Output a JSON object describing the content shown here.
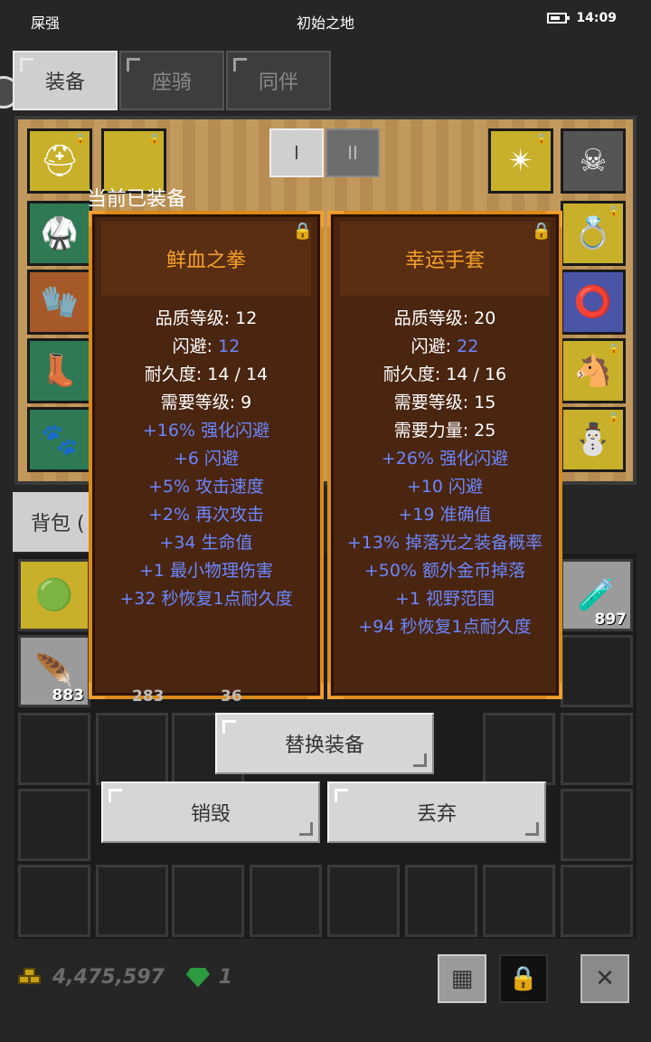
{
  "status": {
    "left": "屎强",
    "title": "初始之地",
    "time": "14:09"
  },
  "tabs": [
    {
      "label": "装备",
      "active": true
    },
    {
      "label": "座骑",
      "active": false
    },
    {
      "label": "同伴",
      "active": false
    }
  ],
  "equip_toggle": [
    "I",
    "II"
  ],
  "equipped_title": "当前已装备",
  "bag_tab_label": "背包 (",
  "compare": [
    {
      "name": "鲜血之拳",
      "stats": [
        {
          "text": "品质等级: 12",
          "color": "white"
        },
        {
          "label": "闪避: ",
          "value": "12",
          "color": "mixed"
        },
        {
          "text": "耐久度: 14 / 14",
          "color": "white"
        },
        {
          "text": "需要等级: 9",
          "color": "white"
        },
        {
          "text": "+16% 强化闪避",
          "color": "blue"
        },
        {
          "text": "+6 闪避",
          "color": "blue"
        },
        {
          "text": "+5% 攻击速度",
          "color": "blue"
        },
        {
          "text": "+2% 再次攻击",
          "color": "blue"
        },
        {
          "text": "+34 生命值",
          "color": "blue"
        },
        {
          "text": "+1 最小物理伤害",
          "color": "blue"
        },
        {
          "text": "+32 秒恢复1点耐久度",
          "color": "blue"
        }
      ]
    },
    {
      "name": "幸运手套",
      "stats": [
        {
          "text": "品质等级: 20",
          "color": "white"
        },
        {
          "label": "闪避: ",
          "value": "22",
          "color": "mixed"
        },
        {
          "text": "耐久度: 14 / 16",
          "color": "white"
        },
        {
          "text": "需要等级: 15",
          "color": "white"
        },
        {
          "text": "需要力量: 25",
          "color": "white"
        },
        {
          "text": "+26% 强化闪避",
          "color": "blue"
        },
        {
          "text": "+10 闪避",
          "color": "blue"
        },
        {
          "text": "+19 准确值",
          "color": "blue"
        },
        {
          "text": "+13% 掉落光之装备概率",
          "color": "blue"
        },
        {
          "text": "+50% 额外金币掉落",
          "color": "blue"
        },
        {
          "text": "+1 视野范围",
          "color": "blue"
        },
        {
          "text": "+94 秒恢复1点耐久度",
          "color": "blue"
        }
      ]
    }
  ],
  "actions": {
    "replace": "替换装备",
    "destroy": "销毁",
    "discard": "丢弃"
  },
  "inventory_counts": {
    "feather": "883",
    "potion": "897",
    "partial1": "283",
    "partial2": "36"
  },
  "currency": {
    "gold": "4,475,597",
    "gems": "1"
  },
  "colors": {
    "accent_orange": "#f5a02a",
    "stat_blue": "#6b87ff",
    "card_border": "#d98a1a"
  }
}
